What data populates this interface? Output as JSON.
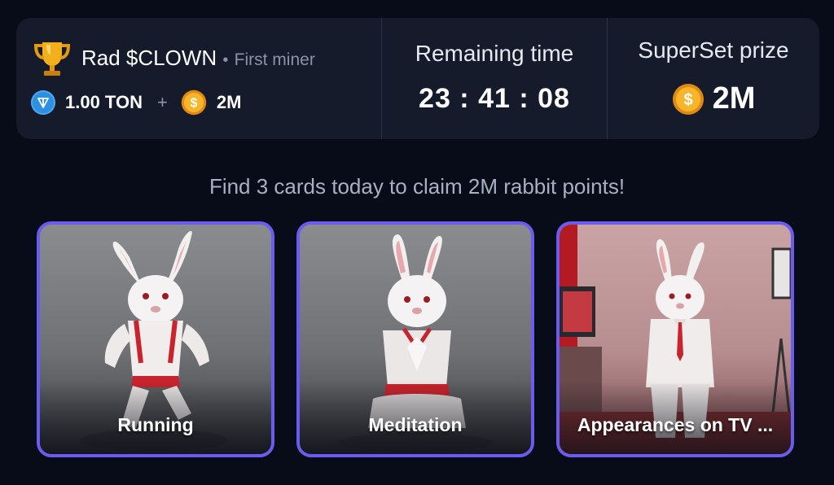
{
  "header": {
    "miner": {
      "name": "Rad $CLOWN",
      "separator": "•",
      "role": "First miner",
      "icon": "trophy-icon"
    },
    "reward": {
      "ton_icon": "ton-icon",
      "ton_amount": "1.00 TON",
      "plus": "+",
      "coin_icon": "coin-icon",
      "coin_amount": "2M"
    },
    "remaining": {
      "title": "Remaining time",
      "timer": "23 : 41 : 08"
    },
    "prize": {
      "title": "SuperSet prize",
      "coin_icon": "coin-icon",
      "value": "2M"
    }
  },
  "subtitle": "Find 3 cards today to claim 2M rabbit points!",
  "cards": [
    {
      "label": "Running"
    },
    {
      "label": "Meditation"
    },
    {
      "label": "Appearances on TV ..."
    }
  ],
  "colors": {
    "background": "#080c18",
    "panel": "#151b2b",
    "card_border": "#6a5cf0",
    "coin": "#f5a623",
    "ton": "#2f8fe0"
  }
}
